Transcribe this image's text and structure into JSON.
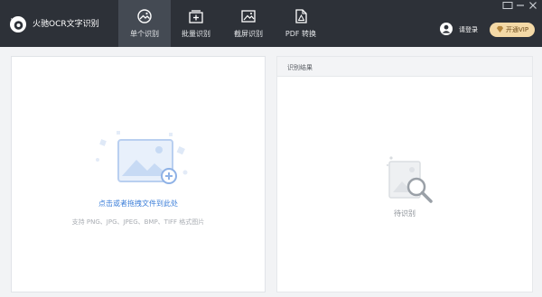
{
  "app": {
    "title": "火驰OCR文字识别"
  },
  "tabs": [
    {
      "label": "单个识别",
      "icon": "single-recognize-icon",
      "active": true
    },
    {
      "label": "批量识别",
      "icon": "batch-recognize-icon",
      "active": false
    },
    {
      "label": "截屏识别",
      "icon": "screenshot-recognize-icon",
      "active": false
    },
    {
      "label": "PDF 转换",
      "icon": "pdf-convert-icon",
      "active": false
    }
  ],
  "header": {
    "login_label": "请登录",
    "vip_label": "开通VIP"
  },
  "upload": {
    "main_text": "点击或者拖拽文件到此处",
    "hint_text": "支持 PNG、JPG、JPEG、BMP、TIFF 格式图片"
  },
  "result": {
    "title": "识别结果",
    "status_text": "待识别"
  },
  "colors": {
    "topbar": "#2d3138",
    "active_tab": "#444a53",
    "accent_blue": "#3d7fd9",
    "vip_gold": "#f4d9a6"
  }
}
